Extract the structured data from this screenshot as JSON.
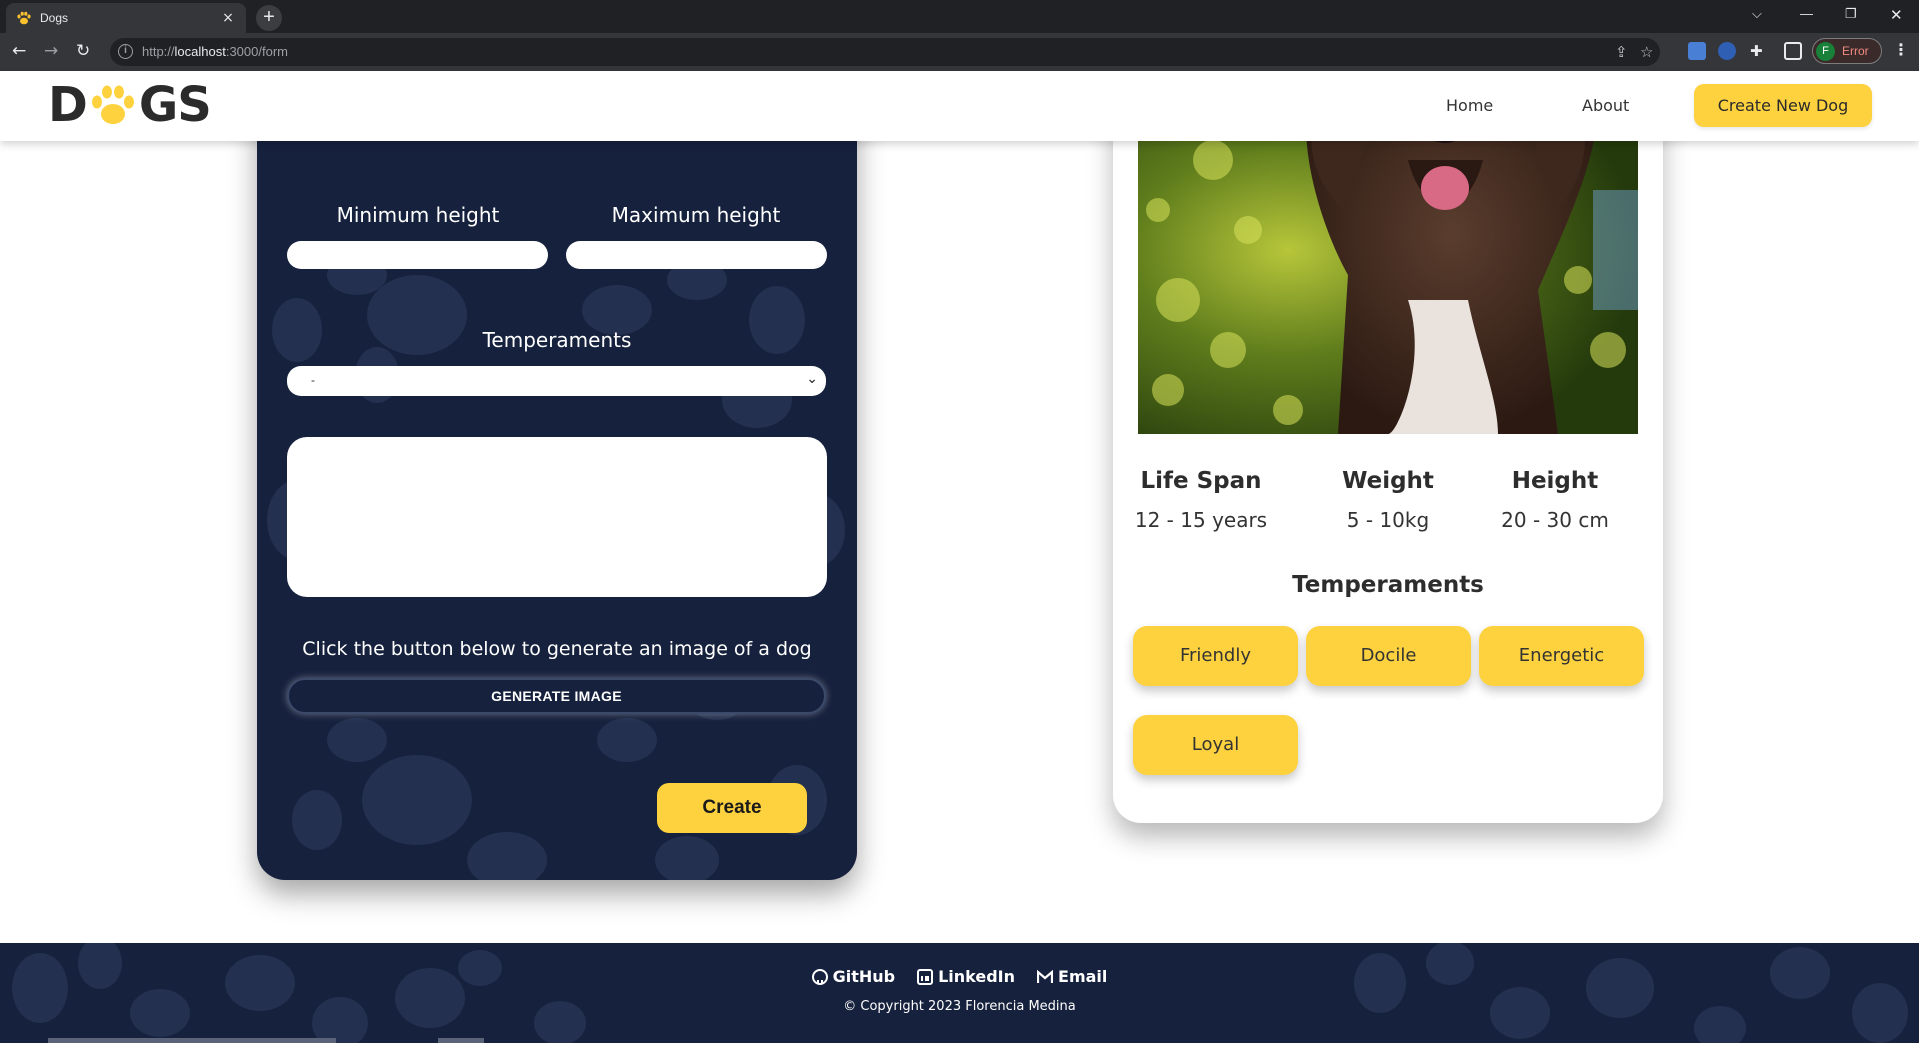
{
  "browser": {
    "tab_title": "Dogs",
    "tab_close": "×",
    "new_tab": "+",
    "url_scheme": "http://",
    "url_host": "localhost",
    "url_path": ":3000/form",
    "profile_initial": "F",
    "profile_status": "Error"
  },
  "header": {
    "logo_left": "D",
    "logo_right": "GS",
    "nav": [
      "Home",
      "About"
    ],
    "cta_label": "Create New Dog",
    "accent_color": "#fdd23e"
  },
  "form": {
    "min_height_label": "Minimum height",
    "max_height_label": "Maximum height",
    "min_height_value": "",
    "max_height_value": "",
    "temperaments_label": "Temperaments",
    "temperaments_selected": "-",
    "description_value": "",
    "generate_prompt": "Click the button below to generate an image of a dog",
    "generate_button": "GENERATE IMAGE",
    "create_button": "Create",
    "panel_color": "#16213d"
  },
  "preview": {
    "stats": [
      {
        "title": "Life Span",
        "value": "12 - 15 years"
      },
      {
        "title": "Weight",
        "value": "5 - 10kg"
      },
      {
        "title": "Height",
        "value": "20 - 30 cm"
      }
    ],
    "temperaments_title": "Temperaments",
    "temperaments": [
      "Friendly",
      "Docile",
      "Energetic",
      "Loyal"
    ]
  },
  "footer": {
    "links": [
      {
        "label": "GitHub",
        "icon": "github-icon"
      },
      {
        "label": "LinkedIn",
        "icon": "linkedin-icon"
      },
      {
        "label": "Email",
        "icon": "gmail-icon"
      }
    ],
    "copyright": "© Copyright 2023 Florencia Medina"
  }
}
